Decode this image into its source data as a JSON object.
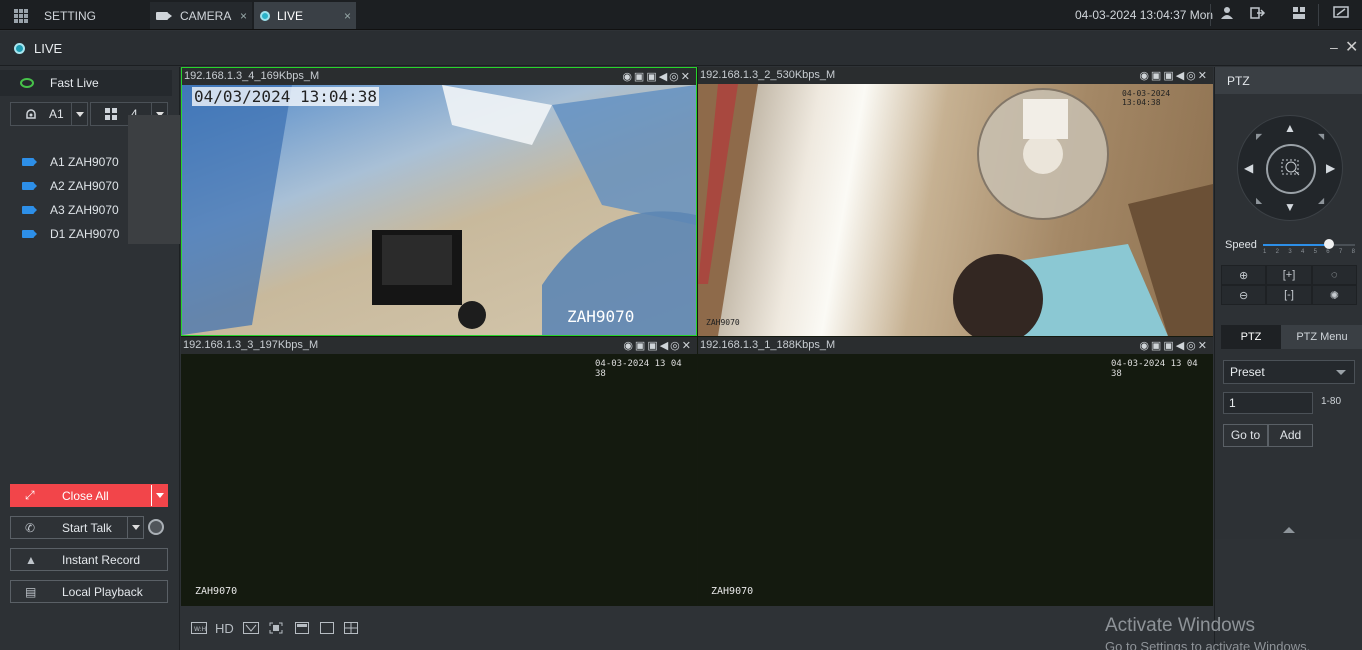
{
  "topbar": {
    "tabs": [
      {
        "label": "SETTING"
      },
      {
        "label": "CAMERA",
        "close": "×"
      },
      {
        "label": "LIVE",
        "close": "×"
      }
    ],
    "datetime": "04-03-2024 13:04:37 Mon"
  },
  "live_header": {
    "title": "LIVE",
    "min": "–",
    "close": "✕"
  },
  "left": {
    "fast_live": "Fast Live",
    "group_select": "A1",
    "split_select": "4",
    "channels": [
      {
        "label": "A1 ZAH9070"
      },
      {
        "label": "A2 ZAH9070"
      },
      {
        "label": "A3 ZAH9070"
      },
      {
        "label": "D1 ZAH9070"
      }
    ],
    "buttons": {
      "close_all": "Close All",
      "start_talk": "Start Talk",
      "instant_record": "Instant Record",
      "local_playback": "Local Playback"
    }
  },
  "panes": [
    {
      "ip": "192.168.1.3_4_169Kbps_M",
      "osd_time": "04/03/2024 13:04:38",
      "osd_name": "ZAH9070"
    },
    {
      "ip": "192.168.1.3_2_530Kbps_M",
      "osd_time": "04-03-2024 13:04:38",
      "osd_name": "ZAH9070"
    },
    {
      "ip": "192.168.1.3_3_197Kbps_M",
      "osd_time": "04-03-2024 13 04 38",
      "osd_name": "ZAH9070"
    },
    {
      "ip": "192.168.1.3_1_188Kbps_M",
      "osd_time": "04-03-2024 13 04 38",
      "osd_name": "ZAH9070"
    }
  ],
  "bottombar": {
    "hd": "HD"
  },
  "watermark": {
    "line1": "Activate Windows",
    "line2": "Go to Settings to activate Windows."
  },
  "ptz": {
    "title": "PTZ",
    "speed_label": "Speed",
    "speed_value": 6,
    "speed_max": 8,
    "speed_scale": [
      "1",
      "2",
      "3",
      "4",
      "5",
      "6",
      "7",
      "8"
    ],
    "tabs": {
      "ptz": "PTZ",
      "menu": "PTZ Menu"
    },
    "preset_select": "Preset",
    "preset_value": "1",
    "preset_range": "1-80",
    "goto": "Go to",
    "add": "Add"
  }
}
